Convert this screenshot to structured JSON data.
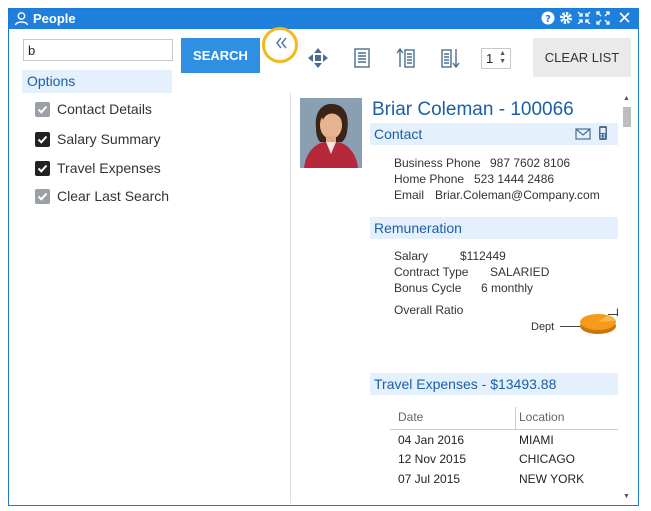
{
  "window": {
    "title": "People"
  },
  "search": {
    "value": "b",
    "button_label": "SEARCH"
  },
  "options": {
    "header": "Options",
    "items": [
      {
        "label": "Contact Details",
        "checked": true,
        "style": "grey"
      },
      {
        "label": "Salary Summary",
        "checked": true,
        "style": "black"
      },
      {
        "label": "Travel Expenses",
        "checked": true,
        "style": "black"
      },
      {
        "label": "Clear Last Search",
        "checked": true,
        "style": "grey"
      }
    ]
  },
  "toolbar": {
    "stepper_value": "1",
    "clear_label": "CLEAR LIST",
    "icons": [
      "move-icon",
      "list-icon",
      "sort-ascending-icon",
      "sort-descending-icon"
    ]
  },
  "person": {
    "name": "Briar Coleman - 100066",
    "contact": {
      "header": "Contact",
      "business_label": "Business Phone",
      "business_value": "987 7602 8106",
      "home_label": "Home Phone",
      "home_value": "523 1444 2486",
      "email_label": "Email",
      "email_value": "Briar.Coleman@Company.com"
    },
    "remuneration": {
      "header": "Remuneration",
      "salary_label": "Salary",
      "salary_value": "$112449",
      "contract_label": "Contract Type",
      "contract_value": "SALARIED",
      "bonus_label": "Bonus Cycle",
      "bonus_value": "6 monthly",
      "ratio_label": "Overall Ratio",
      "pie_label": "Dept",
      "pie_label_right": "E"
    },
    "travel": {
      "header": "Travel Expenses - $13493.88",
      "columns": [
        "Date",
        "Location"
      ],
      "rows": [
        [
          "04 Jan 2016",
          "MIAMI"
        ],
        [
          "12 Nov 2015",
          "CHICAGO"
        ],
        [
          "07 Jul 2015",
          "NEW YORK"
        ]
      ]
    }
  },
  "colors": {
    "titlebar": "#1e80dc",
    "accent": "#2e8fe3",
    "highlight_ring": "#f4b820",
    "section_bg": "#e4f0fb",
    "pie": "#f59a1b"
  }
}
